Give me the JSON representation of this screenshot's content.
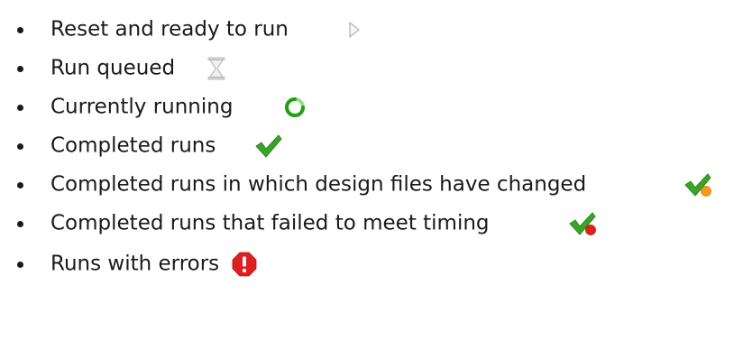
{
  "status_legend": {
    "items": [
      {
        "label": "Reset and ready to run",
        "icon": "play-outline-icon"
      },
      {
        "label": "Run queued",
        "icon": "hourglass-icon"
      },
      {
        "label": "Currently running",
        "icon": "spinner-icon"
      },
      {
        "label": "Completed runs",
        "icon": "checkmark-icon"
      },
      {
        "label": "Completed runs in which design files have changed",
        "icon": "checkmark-orange-dot-icon"
      },
      {
        "label": "Completed runs that failed to meet timing",
        "icon": "checkmark-red-dot-icon"
      },
      {
        "label": "Runs with errors",
        "icon": "error-icon"
      }
    ]
  },
  "colors": {
    "check_green": "#3aa328",
    "spinner_green": "#2eaa1e",
    "changed_orange": "#f39a1c",
    "timing_red": "#e0201b",
    "error_red": "#dd1f1f",
    "icon_gray": "#b9b9b9"
  }
}
